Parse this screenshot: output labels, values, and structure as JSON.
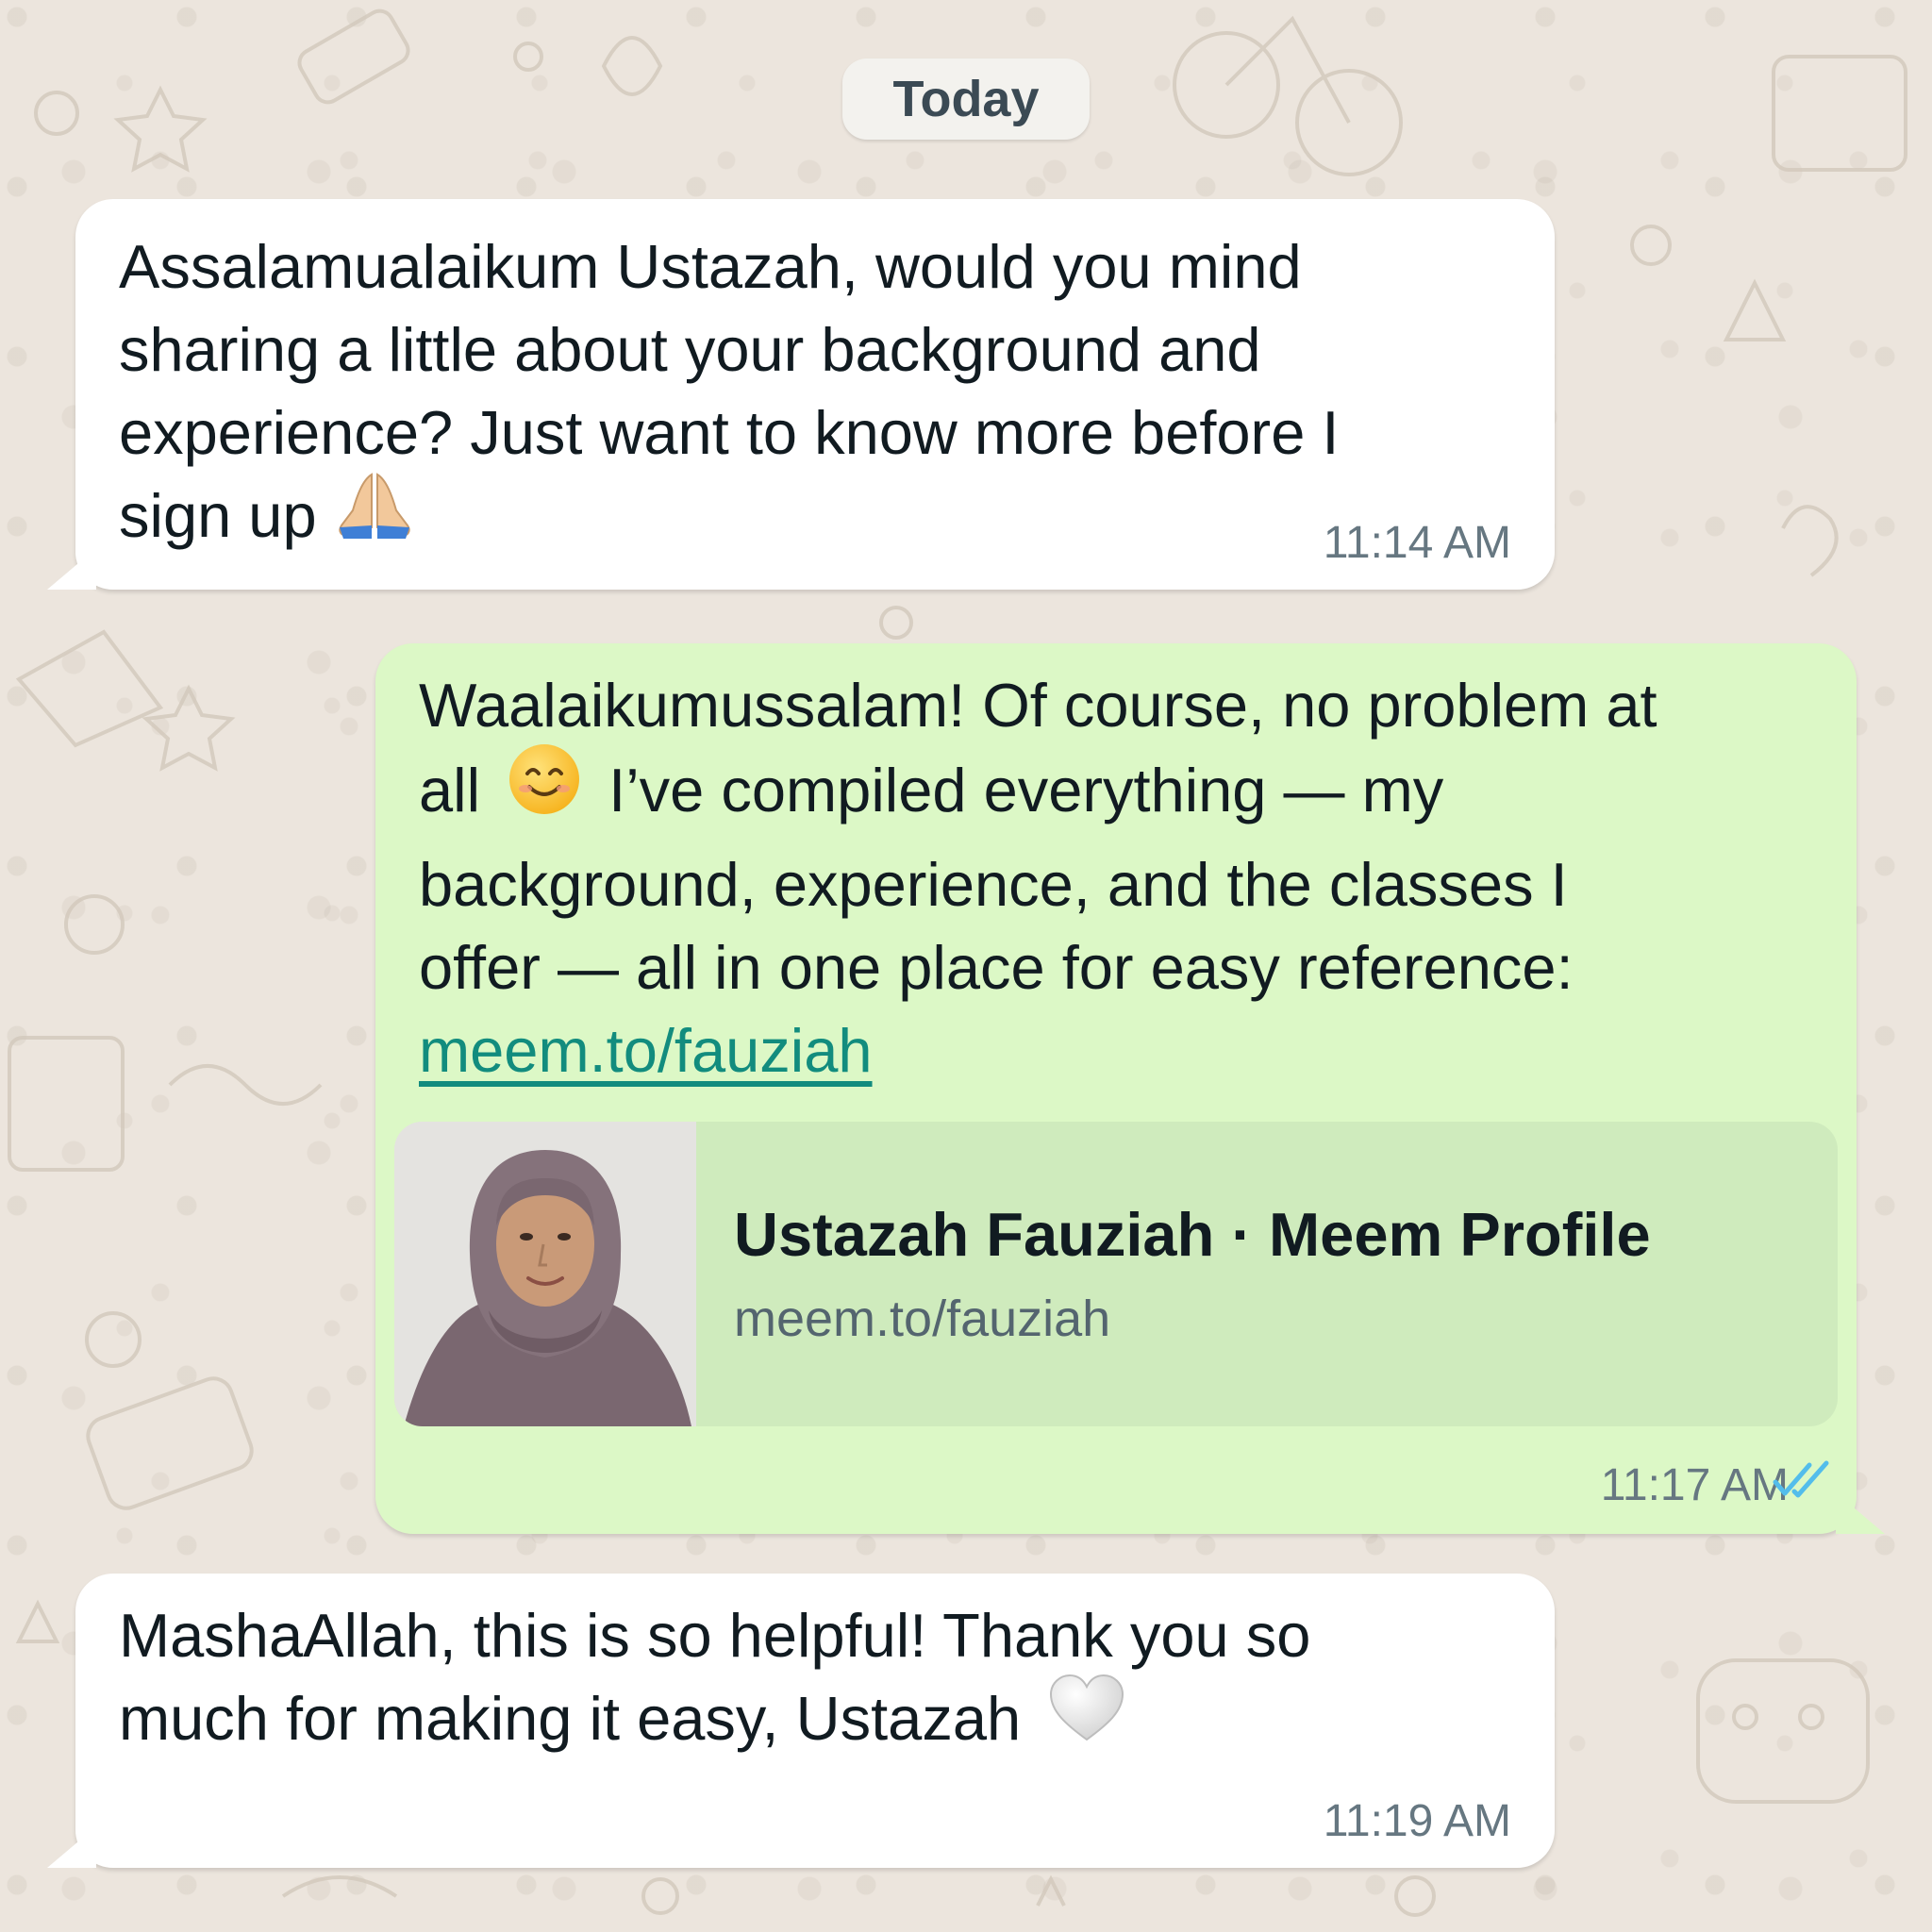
{
  "date_chip": "Today",
  "messages": [
    {
      "direction": "incoming",
      "lines": [
        "Assalamualaikum Ustazah, would you mind",
        "sharing a little about your background and",
        "experience? Just want to know more before I",
        "sign up"
      ],
      "emoji": "praying-hands",
      "time": "11:14 AM"
    },
    {
      "direction": "outgoing",
      "lines": [
        "Waalaikumussalam! Of course, no problem at",
        "all",
        "I’ve compiled everything — my",
        "background, experience, and the classes I",
        "offer — all in one place for easy reference:"
      ],
      "emoji": "smiling-face",
      "link": "meem.to/fauziah",
      "preview": {
        "title": "Ustazah Fauziah · Meem Profile",
        "url": "meem.to/fauziah"
      },
      "time": "11:17 AM",
      "status": "read"
    },
    {
      "direction": "incoming",
      "lines": [
        "MashaAllah, this is so helpful! Thank you so",
        "much for making it easy, Ustazah"
      ],
      "emoji": "white-heart",
      "time": "11:19 AM"
    }
  ],
  "colors": {
    "background": "#ece5dd",
    "incoming_bubble": "#ffffff",
    "outgoing_bubble": "#dcf8c6",
    "link": "#128c7e",
    "read_ticks": "#53bdeb"
  }
}
